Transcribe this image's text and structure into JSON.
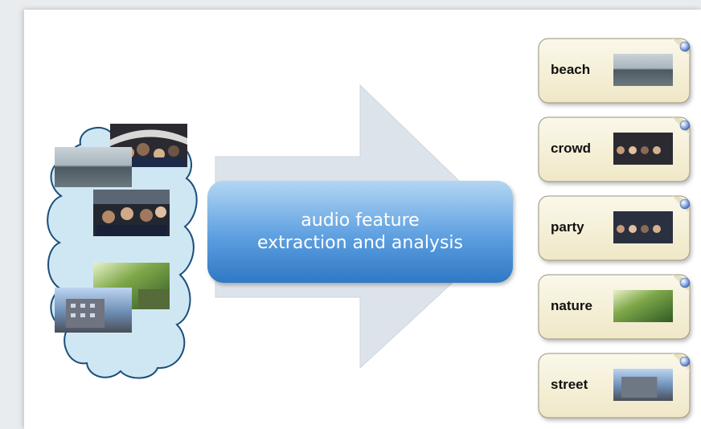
{
  "process": {
    "line1": "audio feature",
    "line2": "extraction and analysis"
  },
  "colors": {
    "cloud_fill": "#cfe7f3",
    "cloud_stroke": "#1c4e7a",
    "arrow_fill": "#dde3ea",
    "box_top": "#a7cef0",
    "box_bottom": "#3a84cf",
    "tag_fill": "#f7f2da",
    "tag_stroke": "#9a9580"
  },
  "categories": [
    {
      "label": "beach",
      "icon": "beach-thumbnail"
    },
    {
      "label": "crowd",
      "icon": "crowd-thumbnail"
    },
    {
      "label": "party",
      "icon": "party-thumbnail"
    },
    {
      "label": "nature",
      "icon": "nature-thumbnail"
    },
    {
      "label": "street",
      "icon": "street-thumbnail"
    }
  ]
}
